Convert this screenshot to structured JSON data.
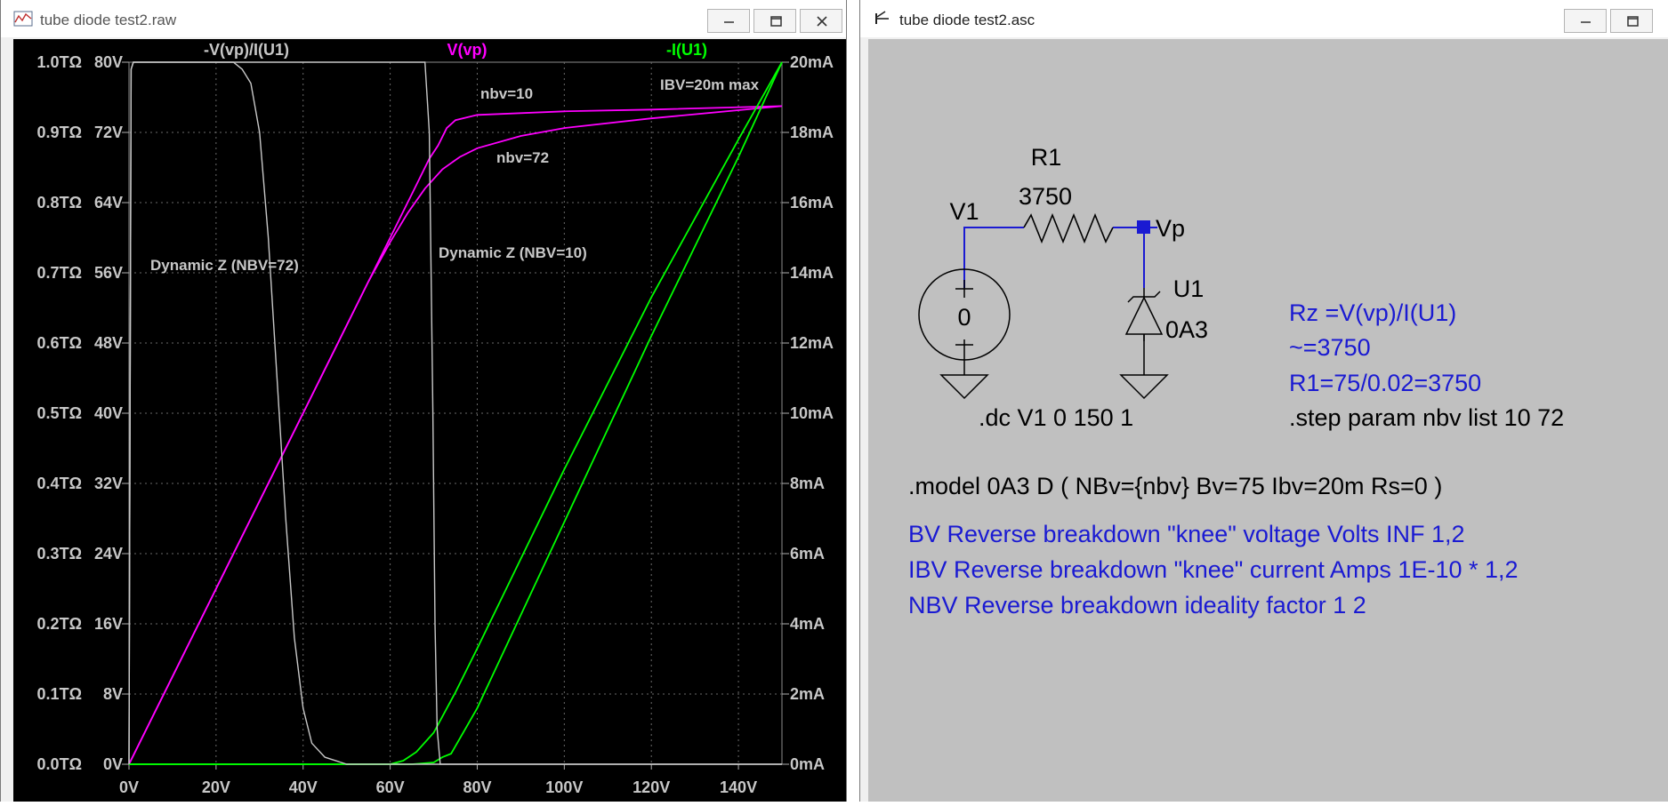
{
  "plot_window": {
    "title": "tube diode test2.raw",
    "traces": [
      {
        "label": "-V(vp)/I(U1)",
        "color": "#c8c8c8"
      },
      {
        "label": "V(vp)",
        "color": "#ff00ff"
      },
      {
        "label": "-I(U1)",
        "color": "#00ff00"
      }
    ],
    "annotations": {
      "nbv10": "nbv=10",
      "nbv72": "nbv=72",
      "ibv": "IBV=20m max",
      "dynz72": "Dynamic Z (NBV=72)",
      "dynz10": "Dynamic Z (NBV=10)"
    }
  },
  "chart_data": {
    "type": "line",
    "xlabel": "",
    "xlim": [
      0,
      150
    ],
    "x_ticks": [
      "0V",
      "20V",
      "40V",
      "60V",
      "80V",
      "100V",
      "120V",
      "140V"
    ],
    "left_ticks_z": [
      "1.0TΩ",
      "0.9TΩ",
      "0.8TΩ",
      "0.7TΩ",
      "0.6TΩ",
      "0.5TΩ",
      "0.4TΩ",
      "0.3TΩ",
      "0.2TΩ",
      "0.1TΩ",
      "0.0TΩ"
    ],
    "left_ticks_v": [
      "80V",
      "72V",
      "64V",
      "56V",
      "48V",
      "40V",
      "32V",
      "24V",
      "16V",
      "8V",
      "0V"
    ],
    "right_ticks": [
      "20mA",
      "18mA",
      "16mA",
      "14mA",
      "12mA",
      "10mA",
      "8mA",
      "6mA",
      "4mA",
      "2mA",
      "0mA"
    ],
    "ylim_z": [
      0,
      1.0
    ],
    "ylim_v": [
      0,
      80
    ],
    "ylim_i": [
      0,
      20
    ],
    "grid": true,
    "series": [
      {
        "name": "V(vp)",
        "step": "nbv=10",
        "axis": "v",
        "color": "#ff00ff",
        "points": [
          [
            0,
            0
          ],
          [
            20,
            20
          ],
          [
            40,
            40
          ],
          [
            60,
            60
          ],
          [
            65,
            65
          ],
          [
            69,
            69
          ],
          [
            71,
            70.5
          ],
          [
            73,
            72.5
          ],
          [
            75,
            73.4
          ],
          [
            80,
            74
          ],
          [
            100,
            74.4
          ],
          [
            120,
            74.6
          ],
          [
            150,
            75
          ]
        ]
      },
      {
        "name": "V(vp)",
        "step": "nbv=72",
        "axis": "v",
        "color": "#ff00ff",
        "points": [
          [
            0,
            0
          ],
          [
            20,
            20
          ],
          [
            40,
            40
          ],
          [
            55,
            55
          ],
          [
            60,
            59.5
          ],
          [
            64,
            62.8
          ],
          [
            68,
            65.6
          ],
          [
            72,
            67.8
          ],
          [
            76,
            69.2
          ],
          [
            80,
            70.2
          ],
          [
            90,
            71.6
          ],
          [
            100,
            72.5
          ],
          [
            120,
            73.6
          ],
          [
            150,
            75
          ]
        ]
      },
      {
        "name": "-I(U1)",
        "step": "nbv=10",
        "axis": "i",
        "color": "#00ff00",
        "points": [
          [
            0,
            0
          ],
          [
            65,
            0
          ],
          [
            70,
            0.05
          ],
          [
            72,
            0.2
          ],
          [
            74,
            0.3
          ],
          [
            80,
            1.6
          ],
          [
            100,
            6.9
          ],
          [
            120,
            12.2
          ],
          [
            140,
            17.3
          ],
          [
            150,
            20
          ]
        ]
      },
      {
        "name": "-I(U1)",
        "step": "nbv=72",
        "axis": "i",
        "color": "#00ff00",
        "points": [
          [
            0,
            0
          ],
          [
            60,
            0
          ],
          [
            63,
            0.1
          ],
          [
            66,
            0.35
          ],
          [
            70,
            0.9
          ],
          [
            75,
            2.05
          ],
          [
            80,
            3.3
          ],
          [
            100,
            8.4
          ],
          [
            120,
            13.3
          ],
          [
            140,
            17.8
          ],
          [
            150,
            20
          ]
        ]
      },
      {
        "name": "-V(vp)/I(U1)",
        "step": "nbv=72",
        "axis": "z",
        "color": "#c8c8c8",
        "points": [
          [
            0,
            0
          ],
          [
            0.5,
            0.99
          ],
          [
            1,
            1.0
          ],
          [
            24,
            1.0
          ],
          [
            26,
            0.99
          ],
          [
            28,
            0.97
          ],
          [
            30,
            0.9
          ],
          [
            32,
            0.75
          ],
          [
            34,
            0.55
          ],
          [
            36,
            0.35
          ],
          [
            38,
            0.18
          ],
          [
            40,
            0.08
          ],
          [
            42,
            0.03
          ],
          [
            45,
            0.01
          ],
          [
            50,
            0.0
          ],
          [
            150,
            0.0
          ]
        ]
      },
      {
        "name": "-V(vp)/I(U1)",
        "step": "nbv=10",
        "axis": "z",
        "color": "#c8c8c8",
        "points": [
          [
            0,
            0
          ],
          [
            0.5,
            0.99
          ],
          [
            1,
            1.0
          ],
          [
            68,
            1.0
          ],
          [
            69,
            0.9
          ],
          [
            69.8,
            0.5
          ],
          [
            70.3,
            0.2
          ],
          [
            70.8,
            0.05
          ],
          [
            71.5,
            0.0
          ],
          [
            150,
            0.0
          ]
        ]
      }
    ]
  },
  "schematic_window": {
    "title": "tube diode test2.asc",
    "components": {
      "r1_name": "R1",
      "r1_value": "3750",
      "v1_name": "V1",
      "v1_value": "0",
      "u1_name": "U1",
      "u1_value": "0A3",
      "node_label": "Vp"
    },
    "directives": {
      "dc": ".dc V1 0 150 1",
      "step": ".step param nbv list 10 72",
      "model": ".model 0A3 D ( NBv={nbv} Bv=75 Ibv=20m Rs=0 )"
    },
    "comments": [
      "Rz =V(vp)/I(U1)",
      "~=3750",
      "R1=75/0.02=3750",
      "BV Reverse breakdown \"knee\" voltage Volts INF 1,2",
      "IBV Reverse breakdown \"knee\" current Amps 1E-10 * 1,2",
      "NBV Reverse breakdown ideality factor 1 2"
    ],
    "colors": {
      "comment": "#1a1ad2",
      "directive": "#000000",
      "wire": "#1a1ad2",
      "component": "#000000"
    }
  }
}
